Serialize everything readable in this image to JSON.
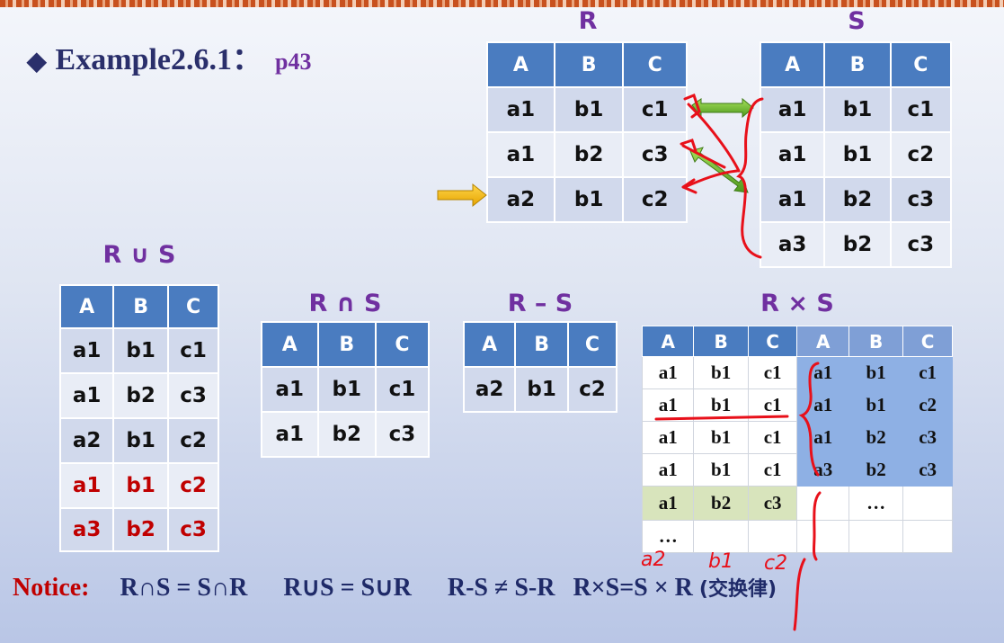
{
  "title": {
    "diamond": "◆",
    "main": "Example2.6.1：",
    "ref": "p43"
  },
  "R": {
    "label": "R",
    "headers": [
      "A",
      "B",
      "C"
    ],
    "rows": [
      [
        "a1",
        "b1",
        "c1"
      ],
      [
        "a1",
        "b2",
        "c3"
      ],
      [
        "a2",
        "b1",
        "c2"
      ]
    ]
  },
  "S": {
    "label": "S",
    "headers": [
      "A",
      "B",
      "C"
    ],
    "rows": [
      [
        "a1",
        "b1",
        "c1"
      ],
      [
        "a1",
        "b1",
        "c2"
      ],
      [
        "a1",
        "b2",
        "c3"
      ],
      [
        "a3",
        "b2",
        "c3"
      ]
    ]
  },
  "union": {
    "label": "R ∪ S",
    "headers": [
      "A",
      "B",
      "C"
    ],
    "rows": [
      [
        "a1",
        "b1",
        "c1"
      ],
      [
        "a1",
        "b2",
        "c3"
      ],
      [
        "a2",
        "b1",
        "c2"
      ],
      [
        "a1",
        "b1",
        "c2"
      ],
      [
        "a3",
        "b2",
        "c3"
      ]
    ]
  },
  "intersect": {
    "label": "R ∩ S",
    "headers": [
      "A",
      "B",
      "C"
    ],
    "rows": [
      [
        "a1",
        "b1",
        "c1"
      ],
      [
        "a1",
        "b2",
        "c3"
      ]
    ]
  },
  "diff": {
    "label": "R – S",
    "headers": [
      "A",
      "B",
      "C"
    ],
    "rows": [
      [
        "a2",
        "b1",
        "c2"
      ]
    ]
  },
  "product": {
    "label": "R × S",
    "headers": [
      "A",
      "B",
      "C",
      "A",
      "B",
      "C"
    ],
    "rows": [
      [
        "a1",
        "b1",
        "c1",
        "a1",
        "b1",
        "c1"
      ],
      [
        "a1",
        "b1",
        "c1",
        "a1",
        "b1",
        "c2"
      ],
      [
        "a1",
        "b1",
        "c1",
        "a1",
        "b2",
        "c3"
      ],
      [
        "a1",
        "b1",
        "c1",
        "a3",
        "b2",
        "c3"
      ],
      [
        "a1",
        "b2",
        "c3",
        "",
        "…",
        ""
      ],
      [
        "…",
        "",
        "",
        "",
        "",
        ""
      ]
    ]
  },
  "notice": {
    "label": "Notice:",
    "eq1": "R∩S = S∩R",
    "eq2": "R∪S = S∪R",
    "eq3": "R-S ≠ S-R",
    "eq4": "R×S=S × R",
    "cn": "(交换律)"
  },
  "handwriting": {
    "a2": "a2",
    "b1": "b1",
    "c2": "c2"
  },
  "colors": {
    "header": "#4a7cc0",
    "label": "#7030a0",
    "red": "#c00000",
    "ink": "#e8101a"
  }
}
